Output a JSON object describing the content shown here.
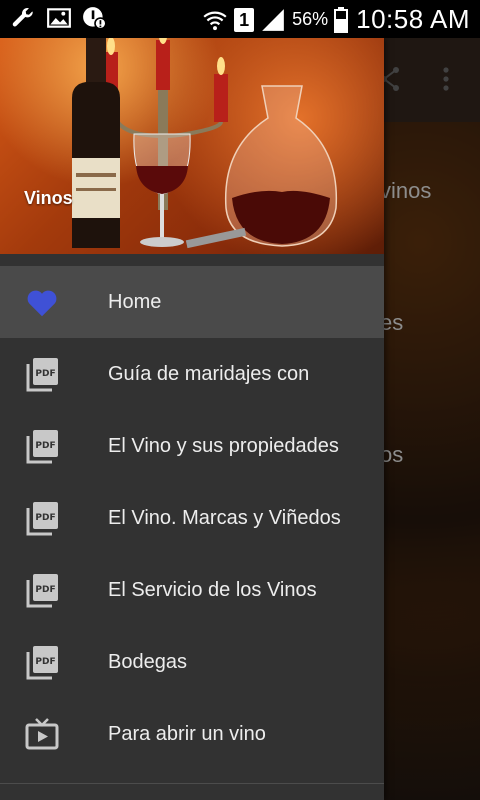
{
  "status_bar": {
    "left_icons": [
      "wrench-icon",
      "image-icon",
      "alert-icon"
    ],
    "sim_number": "1",
    "battery_percent": "56%",
    "time": "10:58 AM"
  },
  "background": {
    "visible_text": [
      "vinos",
      "es",
      "os"
    ]
  },
  "drawer": {
    "header_title": "Vinos",
    "items": [
      {
        "label": "Home",
        "icon": "heart-icon",
        "active": true
      },
      {
        "label": "Guía de maridajes con",
        "icon": "pdf-icon",
        "active": false
      },
      {
        "label": "El Vino y sus propiedades",
        "icon": "pdf-icon",
        "active": false
      },
      {
        "label": "El Vino. Marcas y Viñedos",
        "icon": "pdf-icon",
        "active": false
      },
      {
        "label": "El Servicio de los Vinos",
        "icon": "pdf-icon",
        "active": false
      },
      {
        "label": "Bodegas",
        "icon": "pdf-icon",
        "active": false
      },
      {
        "label": "Para abrir un vino",
        "icon": "tv-icon",
        "active": false
      }
    ]
  },
  "colors": {
    "drawer_bg": "#323232",
    "active_item_bg": "#4a4a4a",
    "heart": "#3f51d6",
    "icon_gray": "#c8c8c8"
  }
}
